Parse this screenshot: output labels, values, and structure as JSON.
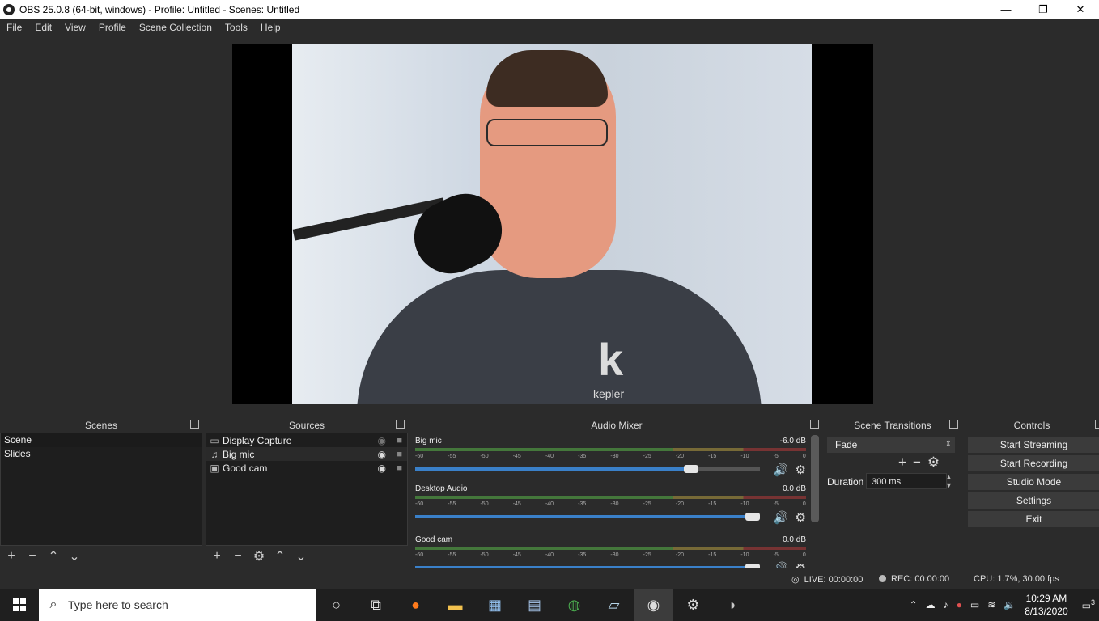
{
  "window": {
    "title": "OBS 25.0.8 (64-bit, windows) - Profile: Untitled - Scenes: Untitled",
    "minimize": "—",
    "restore": "❐",
    "close": "✕"
  },
  "menu": [
    "File",
    "Edit",
    "View",
    "Profile",
    "Scene Collection",
    "Tools",
    "Help"
  ],
  "preview": {
    "shirt_logo": "kepler",
    "shirt_logo_mark": "k"
  },
  "scenes": {
    "title": "Scenes",
    "items": [
      "Scene",
      "Slides"
    ],
    "selected": "Scene"
  },
  "sources": {
    "title": "Sources",
    "items": [
      {
        "name": "Display Capture",
        "icon": "monitor-icon"
      },
      {
        "name": "Big mic",
        "icon": "microphone-icon"
      },
      {
        "name": "Good cam",
        "icon": "camera-icon"
      }
    ]
  },
  "mixer": {
    "title": "Audio Mixer",
    "ticks": [
      "-60",
      "-55",
      "-50",
      "-45",
      "-40",
      "-35",
      "-30",
      "-25",
      "-20",
      "-15",
      "-10",
      "-5",
      "0"
    ],
    "channels": [
      {
        "name": "Big mic",
        "db": "-6.0 dB",
        "volume": 0.8
      },
      {
        "name": "Desktop Audio",
        "db": "0.0 dB",
        "volume": 1.0
      },
      {
        "name": "Good cam",
        "db": "0.0 dB",
        "volume": 1.0
      }
    ]
  },
  "transitions": {
    "title": "Scene Transitions",
    "selected": "Fade",
    "duration_label": "Duration",
    "duration_value": "300 ms"
  },
  "controls": {
    "title": "Controls",
    "buttons": [
      "Start Streaming",
      "Start Recording",
      "Studio Mode",
      "Settings",
      "Exit"
    ]
  },
  "status": {
    "live": "LIVE: 00:00:00",
    "rec": "REC: 00:00:00",
    "cpu": "CPU: 1.7%, 30.00 fps"
  },
  "taskbar": {
    "search_placeholder": "Type here to search",
    "time": "10:29 AM",
    "date": "8/13/2020",
    "notification_count": "3"
  }
}
